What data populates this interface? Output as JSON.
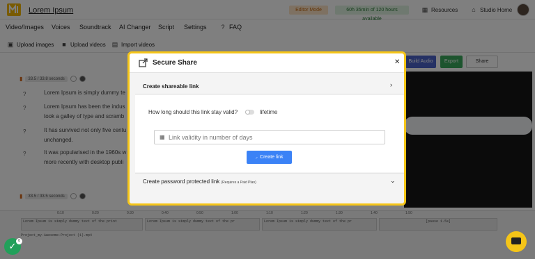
{
  "app": {
    "project_title": "Lorem Ipsum",
    "editor_mode": "Editor Mode",
    "time_available": "60h 35min of 120 hours available",
    "resources": "Resources",
    "studio_home": "Studio Home"
  },
  "menu": [
    "Video/Images",
    "Voices",
    "Soundtrack",
    "AI Changer",
    "Script",
    "Settings",
    "FAQ"
  ],
  "subbar": {
    "upload_images": "Upload images",
    "upload_videos": "Upload videos",
    "import_videos": "Import videos"
  },
  "editor": {
    "seg1_time": "33.5 / 33.8 seconds",
    "seg2_time": "33.5 / 33.5 seconds",
    "lines": [
      "Lorem Ipsum is simply dummy te",
      "Lorem Ipsum has been the indus",
      "took a galley of type and scramb",
      "It has survived not only five centu",
      "unchanged.",
      "It was popularised in the 1960s w",
      "more recently with desktop publi"
    ]
  },
  "right": {
    "build_audio": "Build Audio",
    "export": "Export",
    "share": "Share"
  },
  "timeline": {
    "ticks": [
      "0:10",
      "0:20",
      "0:30",
      "0:40",
      "0:50",
      "1:00",
      "1:10",
      "1:20",
      "1:30",
      "1:40",
      "1:50"
    ],
    "clips": [
      "Lorem Ipsum is simply dummy text of the print",
      "Lorem Ipsum is simply dummy text of the pr",
      "Lorem Ipsum is simply dummy text of the pr",
      "[pause 1.5s]"
    ],
    "file": "Project_my-Awesome-Project (1).mp4"
  },
  "modal": {
    "title": "Secure Share",
    "section1_title": "Create shareable link",
    "valid_question": "How long should this link stay valid?",
    "lifetime_label": "lifetime",
    "days_placeholder": "Link validity in number of days",
    "create_link": "Create link",
    "section2_title": "Create password protected link",
    "section2_note": "(Requires a Paid Plan)"
  },
  "badge_count": "0"
}
